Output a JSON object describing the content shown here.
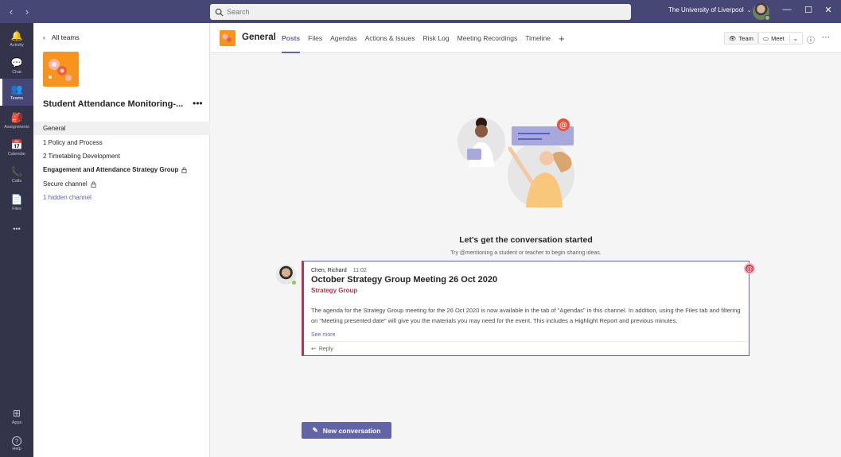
{
  "titlebar": {
    "search_placeholder": "Search",
    "tenant": "The University of Liverpool",
    "back_arrow": "‹",
    "forward_arrow": "›",
    "minimize": "—",
    "maximize": "☐",
    "close": "✕"
  },
  "rail": {
    "items": [
      {
        "label": "Activity",
        "icon": "bell-icon",
        "glyph": "🔔"
      },
      {
        "label": "Chat",
        "icon": "chat-icon",
        "glyph": "💬"
      },
      {
        "label": "Teams",
        "icon": "teams-icon",
        "glyph": "👥"
      },
      {
        "label": "Assignments",
        "icon": "assignments-icon",
        "glyph": "🎒"
      },
      {
        "label": "Calendar",
        "icon": "calendar-icon",
        "glyph": "📅"
      },
      {
        "label": "Calls",
        "icon": "phone-icon",
        "glyph": "📞"
      },
      {
        "label": "Files",
        "icon": "file-icon",
        "glyph": "📄"
      },
      {
        "label": "",
        "icon": "more-icon",
        "glyph": "•••"
      },
      {
        "label": "Apps",
        "icon": "apps-icon",
        "glyph": "⊞"
      },
      {
        "label": "Help",
        "icon": "help-icon",
        "glyph": "?"
      }
    ],
    "active": "Teams"
  },
  "panel": {
    "back_label": "All teams",
    "team_name": "Student Attendance Monitoring-...",
    "more": "•••",
    "channels": [
      {
        "name": "General"
      },
      {
        "name": "1 Policy and Process"
      },
      {
        "name": "2 Timetabling Development"
      },
      {
        "name": "Engagement and Attendance Strategy Group"
      },
      {
        "name": "Secure channel"
      },
      {
        "name": "1 hidden channel"
      }
    ]
  },
  "header": {
    "channel_name": "General",
    "tabs": [
      "Posts",
      "Files",
      "Agendas",
      "Actions & Issues",
      "Risk Log",
      "Meeting Recordings",
      "Timeline"
    ],
    "add_tab": "+",
    "team_button": "Team",
    "meet_button": "Meet",
    "info_icon": "ⓘ",
    "more_icon": "⋯"
  },
  "welcome": {
    "title": "Let's get the conversation started",
    "subtitle": "Try @mentioning a student or teacher to begin sharing ideas."
  },
  "post": {
    "author": "Chen, Richard",
    "time": "11:02",
    "title": "October Strategy Group Meeting 26 Oct 2020",
    "subtitle": "Strategy Group",
    "body": "The agenda for the Strategy Group meeting for the 26 Oct 2020 is now available in the tab of \"Agendas\" in this channel.  In addition, using the Files tab and filtering on \"Meeting presented date\" will give you the materials you may need for the event. This includes a Highlight Report and previous minutes.",
    "see_more": "See more",
    "reply": "Reply",
    "mention": "@"
  },
  "new_conversation": "New conversation",
  "colors": {
    "brand": "#6264a7",
    "titlebar": "#464775",
    "rail": "#33344a",
    "important": "#c4314b",
    "team_logo": "#f7941d"
  }
}
